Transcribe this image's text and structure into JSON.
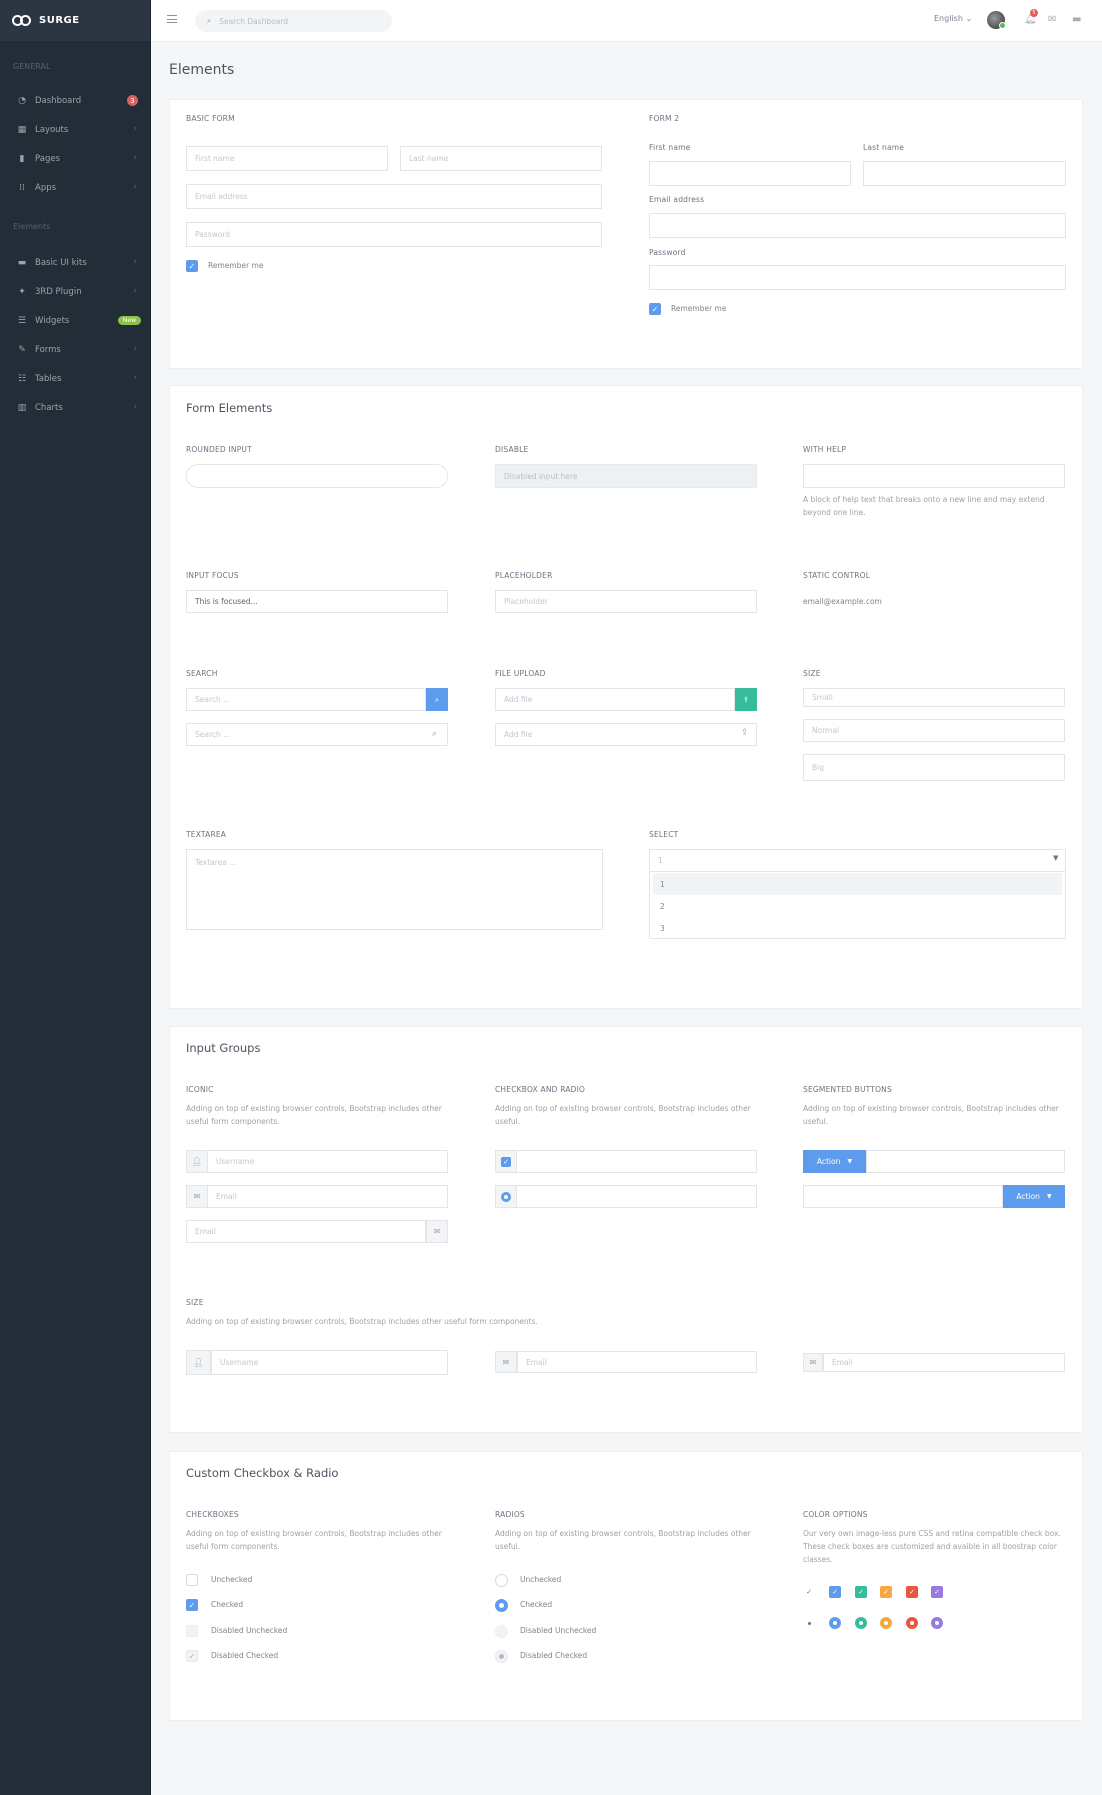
{
  "brand": {
    "name": "SURGE"
  },
  "sidebar": {
    "section1": "GENERAL",
    "section2": "Elements",
    "items": [
      {
        "label": "Dashboard",
        "badge": "3"
      },
      {
        "label": "Layouts"
      },
      {
        "label": "Pages"
      },
      {
        "label": "Apps"
      },
      {
        "label": "Basic UI kits"
      },
      {
        "label": "3RD Plugin"
      },
      {
        "label": "Widgets",
        "badge": "New"
      },
      {
        "label": "Forms"
      },
      {
        "label": "Tables"
      },
      {
        "label": "Charts"
      }
    ]
  },
  "topbar": {
    "search_placeholder": "Search Dashboard",
    "language": "English",
    "notif_count": "5"
  },
  "page": {
    "title": "Elements"
  },
  "basic_form": {
    "title": "BASIC FORM",
    "first": "First name",
    "last": "Last name",
    "email": "Email address",
    "password": "Password",
    "remember": "Remember me"
  },
  "form2": {
    "title": "FORM 2",
    "first": "First name",
    "last": "Last name",
    "email": "Email address",
    "password": "Password",
    "remember": "Remember me"
  },
  "form_elements": {
    "title": "Form Elements",
    "rounded": "ROUNDED INPUT",
    "disable": "DISABLE",
    "disabled_ph": "Disabled input here",
    "with_help": "WITH HELP",
    "help_text": "A block of help text that breaks onto a new line and may extend beyond one line.",
    "focus": "INPUT FOCUS",
    "focus_value": "This is focused...",
    "placeholder": "PLACEHOLDER",
    "placeholder_ph": "Placeholder",
    "static": "STATIC CONTROL",
    "static_value": "email@example.com",
    "search": "SEARCH",
    "search_ph": "Search ...",
    "file": "FILE UPLOAD",
    "file_ph": "Add file",
    "size": "SIZE",
    "small": "Small",
    "normal": "Normal",
    "big": "Big",
    "textarea": "TEXTAREA",
    "textarea_ph": "Textarea ...",
    "select": "SELECT",
    "select_value": "1",
    "options": [
      "1",
      "2",
      "3"
    ]
  },
  "input_groups": {
    "title": "Input Groups",
    "iconic": "ICONIC",
    "iconic_desc": "Adding on top of existing browser controls, Bootstrap includes other useful form components.",
    "username": "Username",
    "email": "Email",
    "cbr": "CHECKBOX AND RADIO",
    "cbr_desc": "Adding on top of existing browser controls, Bootstrap includes other useful.",
    "seg": "SEGMENTED BUTTONS",
    "seg_desc": "Adding on top of existing browser controls, Bootstrap includes other useful.",
    "action": "Action",
    "size": "SIZE",
    "size_desc": "Adding on top of existing browser controls, Bootstrap includes other useful form components."
  },
  "custom": {
    "title": "Custom Checkbox & Radio",
    "cb_title": "CHECKBOXES",
    "cb_desc": "Adding on top of existing browser controls, Bootstrap includes other useful form components.",
    "rd_title": "RADIOS",
    "rd_desc": "Adding on top of existing browser controls, Bootstrap includes other useful.",
    "co_title": "COLOR OPTIONS",
    "co_desc": "Our very own image-less pure CSS and retina compatible check box. These check boxes are customized and avaible in all boostrap color classes.",
    "states": [
      "Unchecked",
      "Checked",
      "Disabled Unchecked",
      "Disabled Checked"
    ],
    "colors": [
      "#ffffff",
      "#5d9cec",
      "#37bc9b",
      "#f6a740",
      "#e9573f",
      "#967adc"
    ]
  }
}
